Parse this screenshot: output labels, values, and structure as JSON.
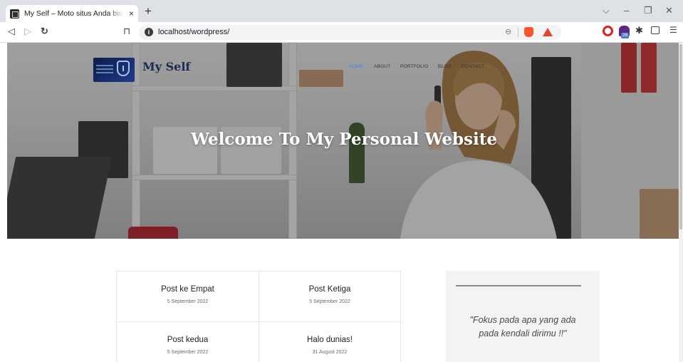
{
  "browser": {
    "tab_title": "My Self – Moto situs Anda bisa di",
    "tab_close": "×",
    "new_tab": "+",
    "url": "localhost/wordpress/",
    "extension_badge": "26",
    "icons": [
      "back-icon",
      "forward-icon",
      "reload-icon",
      "bookmark-icon",
      "info-icon",
      "zoom-icon",
      "brave-shield-icon",
      "bat-rewards-icon",
      "opera-icon",
      "extension-hat-icon",
      "puzzle-icon",
      "sidebar-icon",
      "menu-icon"
    ]
  },
  "site": {
    "title": "My Self",
    "nav": [
      {
        "label": "HOME",
        "active": true
      },
      {
        "label": "ABOUT",
        "active": false
      },
      {
        "label": "PORTFOLIO",
        "active": false
      },
      {
        "label": "BLOG",
        "active": false
      },
      {
        "label": "CONTACT",
        "active": false
      }
    ],
    "hero_heading": "Welcome To My Personal Website",
    "posts": [
      {
        "title": "Post ke Empat",
        "date": "5 September 2022"
      },
      {
        "title": "Post Ketiga",
        "date": "5 September 2022"
      },
      {
        "title": "Post kedua",
        "date": "5 September 2022"
      },
      {
        "title": "Halo dunias!",
        "date": "31 August 2022"
      }
    ],
    "widget_quote": "\"Fokus pada apa yang ada pada kendali dirimu !!\""
  },
  "colors": {
    "nav_active": "#3b82f6",
    "title": "#1b2a55",
    "browser_bar": "#dee1e6"
  }
}
